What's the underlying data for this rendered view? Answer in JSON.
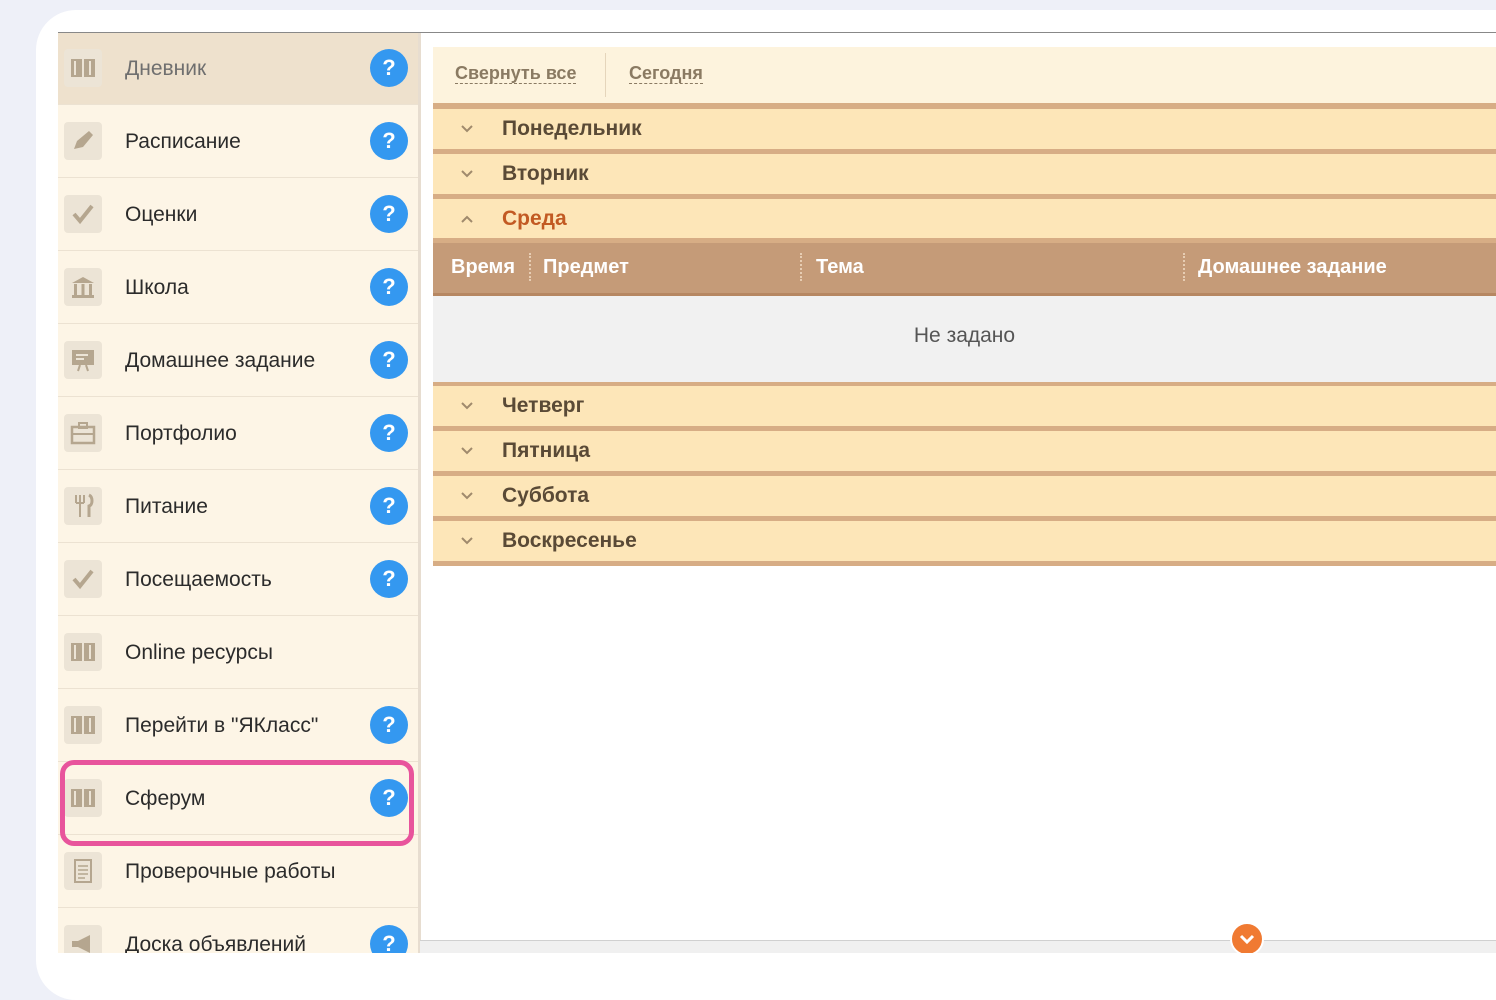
{
  "sidebar": {
    "items": [
      {
        "label": "Дневник",
        "icon": "book-icon",
        "help": "?"
      },
      {
        "label": "Расписание",
        "icon": "pencil-icon",
        "help": "?"
      },
      {
        "label": "Оценки",
        "icon": "checkmark-icon",
        "help": "?"
      },
      {
        "label": "Школа",
        "icon": "school-building-icon",
        "help": "?"
      },
      {
        "label": "Домашнее задание",
        "icon": "chalkboard-icon",
        "help": "?"
      },
      {
        "label": "Портфолио",
        "icon": "briefcase-icon",
        "help": "?"
      },
      {
        "label": "Питание",
        "icon": "fork-knife-icon",
        "help": "?"
      },
      {
        "label": "Посещаемость",
        "icon": "checkmark-icon",
        "help": "?"
      },
      {
        "label": "Online ресурсы",
        "icon": "book-icon",
        "help": ""
      },
      {
        "label": "Перейти в \"ЯКласс\"",
        "icon": "book-icon",
        "help": "?"
      },
      {
        "label": "Сферум",
        "icon": "book-icon",
        "help": "?"
      },
      {
        "label": "Проверочные работы",
        "icon": "document-icon",
        "help": ""
      },
      {
        "label": "Доска объявлений",
        "icon": "megaphone-icon",
        "help": "?"
      }
    ]
  },
  "toolbar": {
    "collapse_all": "Свернуть все",
    "today": "Сегодня"
  },
  "days": [
    {
      "label": "Понедельник",
      "open": false
    },
    {
      "label": "Вторник",
      "open": false
    },
    {
      "label": "Среда",
      "open": true
    },
    {
      "label": "Четверг",
      "open": false
    },
    {
      "label": "Пятница",
      "open": false
    },
    {
      "label": "Суббота",
      "open": false
    },
    {
      "label": "Воскресенье",
      "open": false
    }
  ],
  "table": {
    "headers": [
      "Время",
      "Предмет",
      "Тема",
      "Домашнее задание"
    ],
    "empty_text": "Не задано"
  },
  "colors": {
    "help_button": "#3498f0",
    "highlight": "#e8549c",
    "active_day": "#c25a23",
    "day_row": "#fde6b8",
    "table_header": "#c59b78"
  }
}
